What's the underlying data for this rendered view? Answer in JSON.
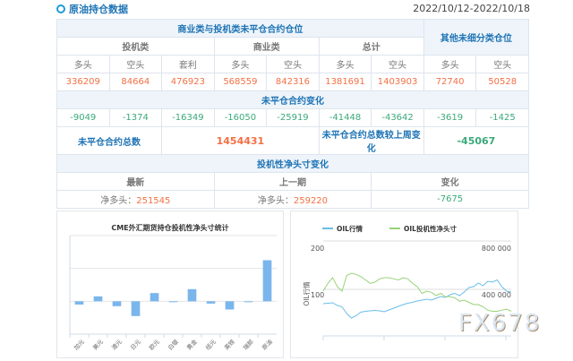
{
  "header": {
    "title": "原油持仓数据",
    "date_range": "2022/10/12-2022/10/18"
  },
  "table": {
    "group_header": "商业类与投机类未平仓合约仓位",
    "other_header": "其他未细分类仓位",
    "sub_headers": [
      "投机类",
      "商业类",
      "总计"
    ],
    "col_labels": [
      "多头",
      "空头",
      "套利",
      "多头",
      "空头",
      "多头",
      "空头",
      "多头",
      "空头"
    ],
    "positions": [
      "336209",
      "84664",
      "476923",
      "568559",
      "842316",
      "1381691",
      "1403903",
      "72740",
      "50528"
    ],
    "change_header": "未平仓合约变化",
    "changes": [
      "-9049",
      "-1374",
      "-16349",
      "-16050",
      "-25919",
      "-41448",
      "-43642",
      "-3619",
      "-1425"
    ],
    "total_label": "未平仓合约总数",
    "total_value": "1454431",
    "total_change_label": "未平仓合约总数较上周变化",
    "total_change_value": "-45067",
    "net_header": "投机性净头寸变化",
    "net_cols": [
      "最新",
      "上一期",
      "变化"
    ],
    "net_prefix": "净多头：",
    "net_latest": "251545",
    "net_previous": "259220",
    "net_change": "-7675"
  },
  "chart_data": [
    {
      "type": "bar",
      "title": "CME外汇期货持仓投机性净头寸统计",
      "categories": [
        "加元",
        "美元",
        "澳元",
        "日元",
        "欧元",
        "白银",
        "黄金",
        "纽元",
        "英镑",
        "瑞郎",
        "原油"
      ],
      "values": [
        -0.1,
        0.15,
        -0.15,
        -0.45,
        0.25,
        0,
        0.37,
        -0.07,
        -0.25,
        -0.02,
        1.25
      ],
      "ylim": [
        -1,
        2
      ],
      "color": "#7ab6ec"
    },
    {
      "type": "line",
      "legend": [
        "OIL行情",
        "OIL投机性净头寸"
      ],
      "ylabel": "OIL行情",
      "y_ticks": [
        "200",
        "100"
      ],
      "y2_ticks": [
        "800 000",
        "400 000"
      ],
      "series": [
        {
          "name": "OIL行情",
          "color": "#6cbde8",
          "values": [
            72,
            73,
            74,
            68,
            65,
            50,
            40,
            45,
            53,
            55,
            56,
            57,
            56,
            54,
            58,
            62,
            66,
            70,
            73,
            75,
            78,
            80,
            82,
            80,
            84,
            88,
            86,
            92,
            95,
            90,
            98,
            108,
            110,
            118,
            112,
            122,
            120,
            125,
            110,
            100,
            98
          ]
        },
        {
          "name": "OIL投机性净头寸",
          "color": "#98d37a",
          "values": [
            400,
            470,
            520,
            440,
            400,
            540,
            560,
            550,
            530,
            500,
            470,
            480,
            510,
            520,
            520,
            510,
            500,
            520,
            510,
            470,
            440,
            380,
            400,
            390,
            360,
            380,
            350,
            350,
            340,
            310,
            320,
            300,
            280,
            280,
            260,
            230,
            220,
            220,
            230,
            240,
            220
          ]
        }
      ]
    }
  ]
}
